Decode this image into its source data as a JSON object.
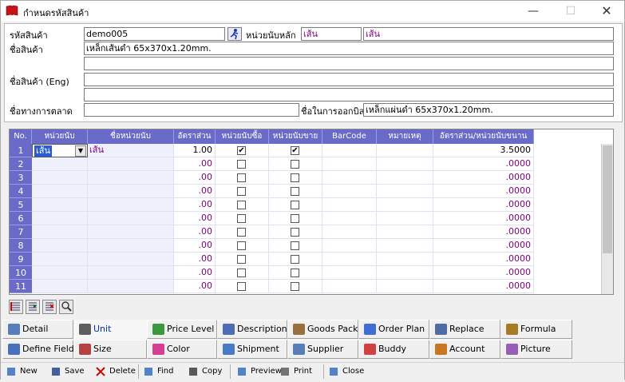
{
  "window": {
    "title": "กำหนดรหัสสินค้า",
    "min": "—",
    "max": "☐",
    "close": "✕"
  },
  "form": {
    "code_label": "รหัสสินค้า",
    "code_value": "demo005",
    "unit_label": "หน่วยนับหลัก",
    "unit_value1": "เส้น",
    "unit_value2": "เส้น",
    "name_label": "ชื่อสินค้า",
    "name_value": "เหล็กเส้นดำ 65x370x1.20mm.",
    "name_en_label": "ชื่อสินค้า (Eng)",
    "market_label": "ชื่อทางการตลาด",
    "invoice_label": "ชื่อในการออกบิล",
    "invoice_value": "เหล็กแผ่นดำ 65x370x1.20mm."
  },
  "grid": {
    "headers": [
      "No.",
      "หน่วยนับ",
      "ชื่อหน่วยนับ",
      "อัตราส่วน",
      "หน่วยนับซื้อ",
      "หน่วยนับขาย",
      "BarCode",
      "หมายเหตุ",
      "อัตราส่วน/หน่วยนับขนาน"
    ],
    "rows": [
      {
        "no": "1",
        "unit": "เส้น",
        "unit_name": "เส้น",
        "ratio": "1.00",
        "buy": true,
        "sell": true,
        "ratio2": "3.5000"
      },
      {
        "no": "2",
        "unit": "",
        "unit_name": "",
        "ratio": ".00",
        "buy": false,
        "sell": false,
        "ratio2": ".0000"
      },
      {
        "no": "3",
        "unit": "",
        "unit_name": "",
        "ratio": ".00",
        "buy": false,
        "sell": false,
        "ratio2": ".0000"
      },
      {
        "no": "4",
        "unit": "",
        "unit_name": "",
        "ratio": ".00",
        "buy": false,
        "sell": false,
        "ratio2": ".0000"
      },
      {
        "no": "5",
        "unit": "",
        "unit_name": "",
        "ratio": ".00",
        "buy": false,
        "sell": false,
        "ratio2": ".0000"
      },
      {
        "no": "6",
        "unit": "",
        "unit_name": "",
        "ratio": ".00",
        "buy": false,
        "sell": false,
        "ratio2": ".0000"
      },
      {
        "no": "7",
        "unit": "",
        "unit_name": "",
        "ratio": ".00",
        "buy": false,
        "sell": false,
        "ratio2": ".0000"
      },
      {
        "no": "8",
        "unit": "",
        "unit_name": "",
        "ratio": ".00",
        "buy": false,
        "sell": false,
        "ratio2": ".0000"
      },
      {
        "no": "9",
        "unit": "",
        "unit_name": "",
        "ratio": ".00",
        "buy": false,
        "sell": false,
        "ratio2": ".0000"
      },
      {
        "no": "10",
        "unit": "",
        "unit_name": "",
        "ratio": ".00",
        "buy": false,
        "sell": false,
        "ratio2": ".0000"
      },
      {
        "no": "11",
        "unit": "",
        "unit_name": "",
        "ratio": ".00",
        "buy": false,
        "sell": false,
        "ratio2": ".0000"
      }
    ]
  },
  "tabs_row1": [
    "Detail",
    "Unit",
    "Price Level",
    "Description",
    "Goods Pack",
    "Order Plan",
    "Replace",
    "Formula"
  ],
  "tabs_row2": [
    "Define Field",
    "Size",
    "Color",
    "Shipment",
    "Supplier",
    "Buddy",
    "Account",
    "Picture"
  ],
  "toolbar": [
    "New",
    "Save",
    "Delete",
    "Find",
    "Copy",
    "Preview",
    "Print",
    "Close"
  ],
  "colors": {
    "header": "#6a6ac8",
    "purple_text": "#800080",
    "accent_red": "#d00000"
  }
}
